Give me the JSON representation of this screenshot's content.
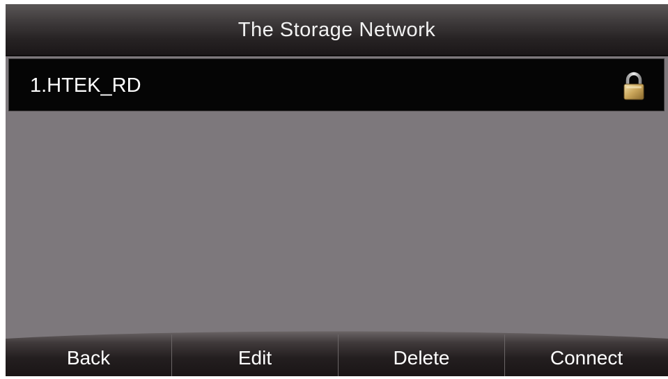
{
  "title": "The Storage Network",
  "networks": [
    {
      "label": "1.HTEK_RD",
      "icon": "lock-icon"
    }
  ],
  "softkeys": [
    {
      "label": "Back"
    },
    {
      "label": "Edit"
    },
    {
      "label": "Delete"
    },
    {
      "label": "Connect"
    }
  ],
  "colors": {
    "background": "#7d787c",
    "selected_row": "#050505",
    "title_bar": "#262223",
    "lock_gold": "#c9a55a"
  }
}
